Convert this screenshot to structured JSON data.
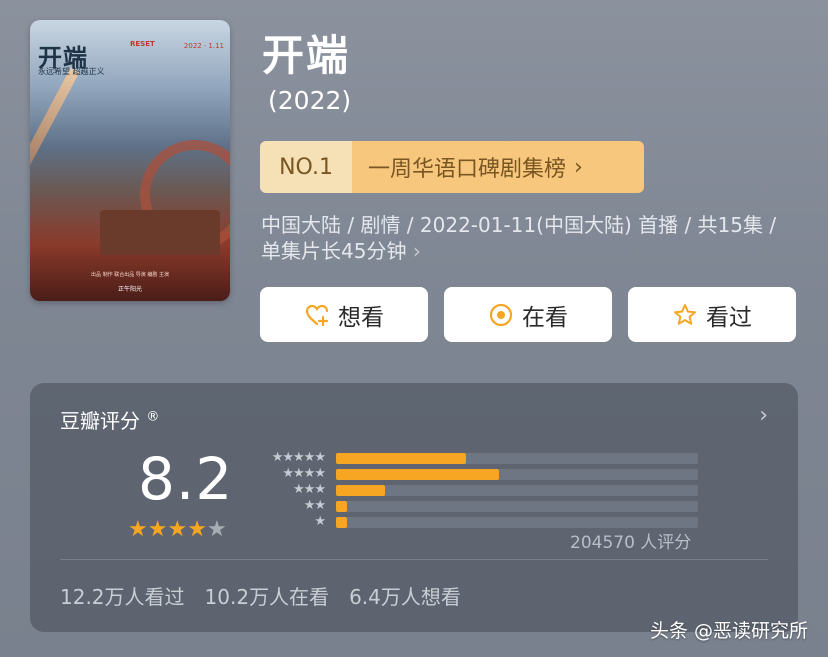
{
  "poster": {
    "logo": "开端",
    "logo_en": "RESET",
    "tagline": "永远希望  超越正义",
    "date": "2022 · 1.11",
    "credits": "出品 制作 联合出品 导演 编剧 主演",
    "studio": "正午阳光"
  },
  "show": {
    "title": "开端",
    "year": "(2022)"
  },
  "rank": {
    "number": "NO.1",
    "label": "一周华语口碑剧集榜",
    "chevron": "›"
  },
  "meta": {
    "text": "中国大陆 / 剧情 / 2022-01-11(中国大陆) 首播 / 共15集 / 单集片长45分钟",
    "chevron": "›"
  },
  "actions": {
    "want": "想看",
    "watching": "在看",
    "watched": "看过"
  },
  "rating": {
    "header": "豆瓣评分",
    "registered": "®",
    "score": "8.2",
    "stars_filled": 4,
    "stars_total": 5,
    "distribution": [
      {
        "stars": 5,
        "fraction": 0.36
      },
      {
        "stars": 4,
        "fraction": 0.45
      },
      {
        "stars": 3,
        "fraction": 0.135
      },
      {
        "stars": 2,
        "fraction": 0.03
      },
      {
        "stars": 1,
        "fraction": 0.03
      }
    ],
    "count_text": "204570 人评分"
  },
  "stats": {
    "watched": "12.2万人看过",
    "watching": "10.2万人在看",
    "want": "6.4万人想看"
  },
  "watermark": "头条 @恶读研究所",
  "colors": {
    "accent": "#f6a623",
    "badge_no_bg": "#f6e0b5",
    "badge_label_bg": "#f7c77d",
    "badge_text": "#7a5622"
  }
}
